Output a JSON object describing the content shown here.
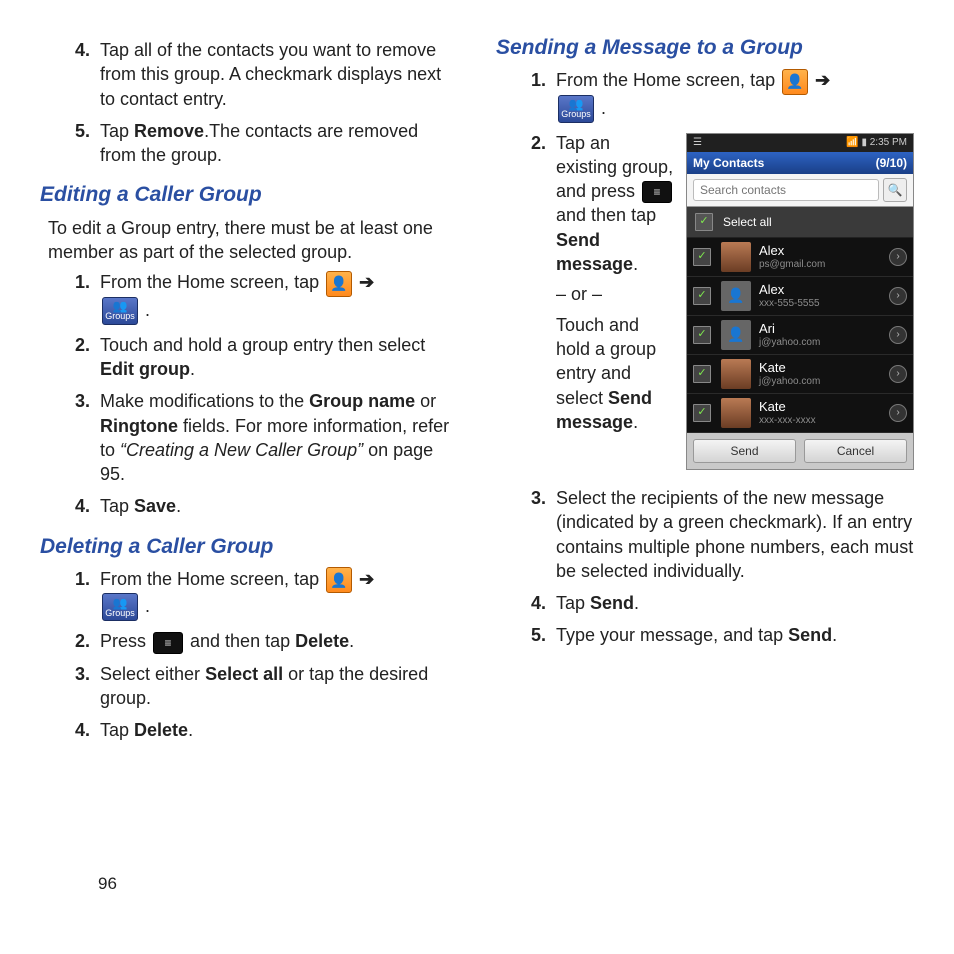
{
  "page_number": "96",
  "left": {
    "top_steps": [
      {
        "n": "4.",
        "text": "Tap all of the contacts you want to remove from this group. A checkmark displays next to contact entry."
      },
      {
        "n": "5.",
        "pre": "Tap ",
        "bold": "Remove",
        "post": ".The contacts are removed from the group."
      }
    ],
    "edit": {
      "heading": "Editing a Caller Group",
      "intro": "To edit a Group entry, there must be at least one member as part of the selected group.",
      "steps": {
        "s1": {
          "n": "1.",
          "pre": "From the Home screen, tap ",
          "arrow": "➔"
        },
        "s2": {
          "n": "2.",
          "pre": "Touch and hold a group entry then select ",
          "bold": "Edit group",
          "post": "."
        },
        "s3": {
          "n": "3.",
          "a": "Make modifications to the ",
          "b1": "Group name",
          "mid": " or ",
          "b2": "Ringtone",
          "c": " fields. For more information, refer to ",
          "ref": "“Creating a New Caller Group”",
          "d": "  on page 95."
        },
        "s4": {
          "n": "4.",
          "pre": "Tap ",
          "bold": "Save",
          "post": "."
        }
      }
    },
    "del": {
      "heading": "Deleting a Caller Group",
      "steps": {
        "s1": {
          "n": "1.",
          "pre": "From the Home screen, tap ",
          "arrow": "➔"
        },
        "s2": {
          "n": "2.",
          "a": "Press ",
          "b": " and then tap ",
          "bold": "Delete",
          "post": "."
        },
        "s3": {
          "n": "3.",
          "a": "Select either ",
          "bold": "Select all",
          "b": " or tap the desired group."
        },
        "s4": {
          "n": "4.",
          "pre": "Tap ",
          "bold": "Delete",
          "post": "."
        }
      }
    }
  },
  "right": {
    "heading": "Sending a Message to a Group",
    "s1": {
      "n": "1.",
      "pre": "From the Home screen, tap ",
      "arrow": "➔"
    },
    "s2": {
      "n": "2.",
      "a": "Tap an existing group, and press ",
      "b": " and then tap ",
      "bold1": "Send message",
      "post1": ".",
      "or": "– or –",
      "c": "Touch and hold a group entry and select ",
      "bold2": "Send message",
      "post2": "."
    },
    "s3": {
      "n": "3.",
      "text": "Select the recipients of the new message (indicated by a green checkmark). If an entry contains multiple phone numbers, each must be selected individually."
    },
    "s4": {
      "n": "4.",
      "pre": "Tap ",
      "bold": "Send",
      "post": "."
    },
    "s5": {
      "n": "5.",
      "pre": "Type your message, and tap ",
      "bold": "Send",
      "post": "."
    }
  },
  "icons": {
    "groups_label": "Groups",
    "contacts_glyph": "👤",
    "groups_glyph": "👥",
    "menu_glyph": "≡"
  },
  "phone": {
    "time": "2:35 PM",
    "title": "My Contacts",
    "count": "(9/10)",
    "search_placeholder": "Search contacts",
    "select_all": "Select all",
    "rows": [
      {
        "name": "Alex",
        "sub": "ps@gmail.com",
        "photo": true
      },
      {
        "name": "Alex",
        "sub": "xxx-555-5555",
        "photo": false
      },
      {
        "name": "Ari",
        "sub": "j@yahoo.com",
        "photo": false
      },
      {
        "name": "Kate",
        "sub": "j@yahoo.com",
        "photo": true
      },
      {
        "name": "Kate",
        "sub": "xxx-xxx-xxxx",
        "photo": true
      }
    ],
    "send": "Send",
    "cancel": "Cancel"
  }
}
